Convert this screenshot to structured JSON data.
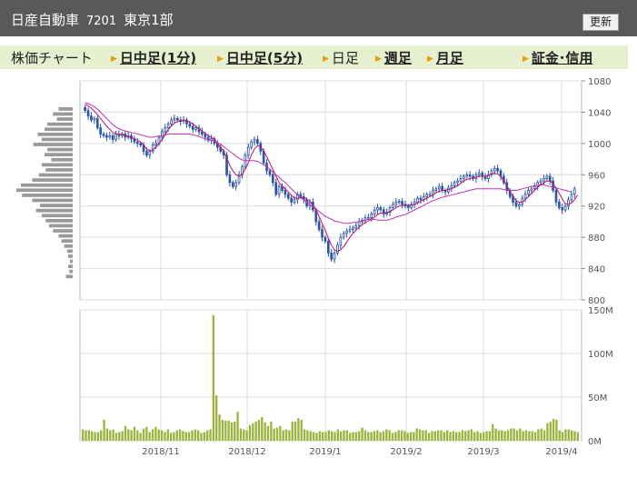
{
  "header": {
    "company": "日産自動車",
    "code": "7201",
    "market": "東京1部",
    "refresh_label": "更新"
  },
  "tabs": {
    "chart_label": "株価チャート",
    "intraday1": "日中足(1分)",
    "intraday5": "日中足(5分)",
    "daily": "日足",
    "weekly": "週足",
    "monthly": "月足",
    "margin": "証金･信用"
  },
  "colors": {
    "header_bg": "#595959",
    "tabbar_bg": "#e6f0cf",
    "arrow": "#e89a10",
    "candle": "#2a55a8",
    "ma_short": "#c01070",
    "ma_long": "#c030c0",
    "volume": "#9ab43c",
    "profile": "#999999",
    "grid": "#dcdcdc"
  },
  "chart_data": [
    {
      "type": "candlestick",
      "ylim": [
        800,
        1080
      ],
      "yticks": [
        800,
        840,
        880,
        920,
        960,
        1000,
        1040,
        1080
      ],
      "xticks": [
        "2018/11",
        "2018/12",
        "2019/1",
        "2019/2",
        "2019/3",
        "2019/4"
      ],
      "close": [
        1042,
        1035,
        1030,
        1032,
        1020,
        1012,
        1010,
        1008,
        1010,
        1005,
        1012,
        1010,
        1012,
        1008,
        1010,
        1006,
        1002,
        1000,
        998,
        990,
        985,
        990,
        998,
        1000,
        1008,
        1015,
        1020,
        1025,
        1030,
        1032,
        1030,
        1028,
        1030,
        1025,
        1022,
        1018,
        1020,
        1015,
        1012,
        1008,
        1004,
        1006,
        1000,
        995,
        990,
        985,
        960,
        950,
        945,
        950,
        960,
        970,
        985,
        995,
        1002,
        1005,
        1000,
        990,
        975,
        965,
        960,
        950,
        935,
        945,
        940,
        935,
        930,
        925,
        928,
        935,
        932,
        928,
        920,
        925,
        915,
        900,
        890,
        880,
        875,
        860,
        852,
        860,
        870,
        880,
        885,
        888,
        890,
        892,
        895,
        900,
        902,
        905,
        905,
        910,
        915,
        918,
        915,
        910,
        912,
        918,
        922,
        925,
        926,
        922,
        920,
        918,
        922,
        925,
        930,
        928,
        932,
        935,
        935,
        940,
        942,
        945,
        940,
        938,
        943,
        946,
        950,
        952,
        955,
        958,
        960,
        958,
        955,
        960,
        962,
        958,
        955,
        960,
        965,
        968,
        965,
        958,
        950,
        940,
        932,
        925,
        920,
        922,
        930,
        935,
        940,
        942,
        945,
        950,
        952,
        955,
        958,
        952,
        940,
        925,
        918,
        915,
        920,
        928,
        935,
        942
      ],
      "ma_short": [
        1050,
        1048,
        1045,
        1041,
        1037,
        1032,
        1027,
        1022,
        1018,
        1014,
        1013,
        1011,
        1012,
        1010,
        1009,
        1008,
        1006,
        1004,
        1002,
        998,
        993,
        990,
        992,
        995,
        1000,
        1005,
        1011,
        1018,
        1022,
        1026,
        1028,
        1029,
        1030,
        1029,
        1027,
        1025,
        1022,
        1019,
        1016,
        1013,
        1010,
        1008,
        1005,
        1000,
        995,
        990,
        982,
        972,
        965,
        960,
        958,
        960,
        967,
        975,
        985,
        993,
        997,
        996,
        990,
        983,
        975,
        967,
        958,
        950,
        945,
        942,
        938,
        934,
        930,
        930,
        931,
        931,
        929,
        926,
        922,
        915,
        907,
        898,
        889,
        879,
        870,
        864,
        862,
        864,
        868,
        874,
        880,
        885,
        889,
        893,
        896,
        899,
        901,
        903,
        906,
        909,
        911,
        911,
        911,
        913,
        915,
        918,
        920,
        921,
        921,
        921,
        921,
        922,
        924,
        926,
        928,
        930,
        932,
        934,
        937,
        939,
        940,
        940,
        941,
        942,
        944,
        946,
        949,
        952,
        954,
        955,
        956,
        957,
        958,
        958,
        958,
        959,
        961,
        962,
        961,
        958,
        952,
        946,
        938,
        932,
        927,
        925,
        925,
        928,
        932,
        936,
        940,
        944,
        947,
        950,
        952,
        952,
        949,
        943,
        936,
        929,
        923,
        922,
        924,
        928,
        934
      ],
      "ma_long": [
        1052,
        1051,
        1049,
        1047,
        1044,
        1040,
        1036,
        1032,
        1028,
        1024,
        1021,
        1019,
        1017,
        1016,
        1015,
        1014,
        1013,
        1012,
        1011,
        1010,
        1009,
        1008,
        1008,
        1009,
        1009,
        1010,
        1011,
        1012,
        1012,
        1012,
        1012,
        1012,
        1012,
        1012,
        1012,
        1011,
        1010,
        1009,
        1007,
        1006,
        1005,
        1004,
        1003,
        1001,
        999,
        996,
        993,
        990,
        987,
        984,
        981,
        979,
        978,
        978,
        978,
        978,
        977,
        975,
        973,
        970,
        967,
        964,
        960,
        957,
        953,
        950,
        946,
        942,
        938,
        934,
        931,
        928,
        925,
        922,
        919,
        916,
        913,
        910,
        907,
        905,
        903,
        901,
        900,
        899,
        898,
        898,
        898,
        899,
        899,
        900,
        901,
        902,
        903,
        903,
        903,
        902,
        902,
        902,
        902,
        903,
        904,
        906,
        907,
        908,
        909,
        911,
        913,
        915,
        917,
        919,
        921,
        923,
        925,
        927,
        928,
        930,
        931,
        932,
        933,
        934,
        935,
        936,
        937,
        938,
        939,
        940,
        941,
        942,
        942,
        942,
        942,
        942,
        942,
        942,
        942,
        942,
        941,
        940,
        940,
        940,
        940,
        941,
        942,
        943,
        944,
        945,
        946,
        946,
        947,
        947,
        946,
        945,
        944,
        943,
        942,
        941,
        940,
        939,
        938
      ],
      "volume_profile": [
        0.25,
        0.35,
        0.28,
        0.45,
        0.5,
        0.62,
        0.55,
        0.7,
        0.45,
        0.5,
        0.38,
        0.55,
        0.48,
        0.6,
        0.72,
        0.92,
        1.0,
        0.9,
        0.72,
        0.58,
        0.65,
        0.55,
        0.48,
        0.42,
        0.35,
        0.25,
        0.2,
        0.15,
        0.1,
        0.08,
        0.05,
        0.08,
        0.06,
        0.12
      ]
    },
    {
      "type": "bar",
      "ylim": [
        0,
        150
      ],
      "yticks": [
        0,
        50,
        100,
        150
      ],
      "yticklabels": [
        "0M",
        "50M",
        "100M",
        "150M"
      ],
      "values": [
        13,
        12,
        12,
        11,
        10,
        10,
        12,
        24,
        14,
        12,
        13,
        9,
        10,
        11,
        17,
        13,
        12,
        16,
        12,
        9,
        14,
        16,
        10,
        13,
        16,
        13,
        12,
        10,
        13,
        9,
        10,
        12,
        13,
        11,
        10,
        10,
        12,
        13,
        12,
        9,
        10,
        12,
        13,
        144,
        52,
        30,
        24,
        23,
        23,
        21,
        22,
        33,
        14,
        13,
        12,
        18,
        20,
        22,
        24,
        27,
        21,
        17,
        22,
        14,
        15,
        17,
        12,
        13,
        12,
        22,
        22,
        26,
        24,
        13,
        12,
        11,
        10,
        9,
        11,
        10,
        10,
        12,
        11,
        10,
        13,
        11,
        12,
        12,
        9,
        10,
        10,
        11,
        15,
        12,
        10,
        10,
        11,
        12,
        10,
        11,
        13,
        12,
        9,
        10,
        12,
        12,
        11,
        9,
        10,
        10,
        14,
        13,
        12,
        12,
        9,
        11,
        11,
        12,
        12,
        10,
        12,
        10,
        11,
        10,
        10,
        12,
        11,
        12,
        13,
        10,
        11,
        9,
        10,
        11,
        11,
        19,
        14,
        12,
        12,
        11,
        12,
        14,
        14,
        12,
        14,
        11,
        12,
        11,
        11,
        10,
        13,
        14,
        12,
        20,
        22,
        25,
        24,
        12,
        10,
        13,
        13,
        12,
        11,
        10
      ]
    }
  ]
}
